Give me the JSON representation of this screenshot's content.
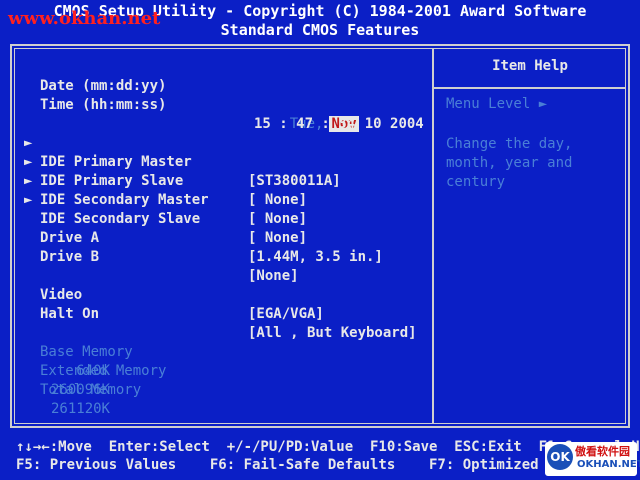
{
  "watermark": "www.okhan.net",
  "header": {
    "line1": "CMOS Setup Utility - Copyright (C) 1984-2001 Award Software",
    "line2": "Standard CMOS Features"
  },
  "settings": {
    "date": {
      "label": "Date (mm:dd:yy)",
      "day": "Tue,",
      "month": "Nov",
      "rest": "10 2004"
    },
    "time": {
      "label": "Time (hh:mm:ss)",
      "value": "15 : 47 : 34"
    },
    "ide_primary_master": {
      "label": "IDE Primary Master",
      "value": "[ST380011A]"
    },
    "ide_primary_slave": {
      "label": "IDE Primary Slave",
      "value": "[ None]"
    },
    "ide_secondary_master": {
      "label": "IDE Secondary Master",
      "value": "[ None]"
    },
    "ide_secondary_slave": {
      "label": "IDE Secondary Slave",
      "value": "[ None]"
    },
    "drive_a": {
      "label": "Drive A",
      "value": "[1.44M, 3.5 in.]"
    },
    "drive_b": {
      "label": "Drive B",
      "value": "[None]"
    },
    "video": {
      "label": "Video",
      "value": "[EGA/VGA]"
    },
    "halt_on": {
      "label": "Halt On",
      "value": "[All , But Keyboard]"
    },
    "base_memory": {
      "label": "Base Memory",
      "value": "640K"
    },
    "extended_memory": {
      "label": "Extended Memory",
      "value": "260096K"
    },
    "total_memory": {
      "label": "Total Memory",
      "value": "261120K"
    }
  },
  "help": {
    "title": "Item Help",
    "menu_level": "Menu Level",
    "text": "Change the day, month, year and century"
  },
  "footer": {
    "line1": "↑↓→←:Move  Enter:Select  +/-/PU/PD:Value  F10:Save  ESC:Exit  F1:General Help",
    "line2": "F5: Previous Values    F6: Fail-Safe Defaults    F7: Optimized Defaults"
  },
  "logo": {
    "mark": "OK",
    "top": "傲看软件园",
    "bottom": "OKHAN.NET"
  }
}
